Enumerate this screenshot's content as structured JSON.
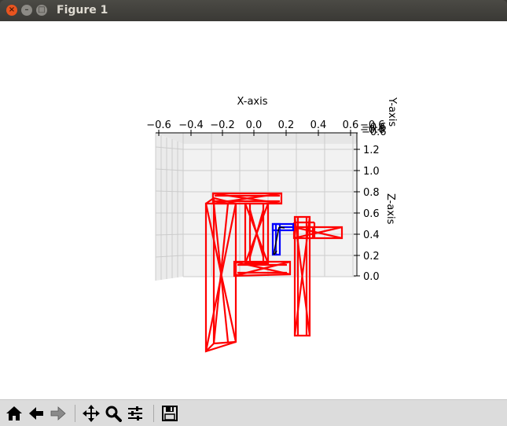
{
  "window": {
    "title": "Figure 1",
    "close_glyph": "×",
    "minimize_glyph": "–",
    "maximize_glyph": "□"
  },
  "axes": {
    "x_label": "X-axis",
    "y_label": "Y-axis",
    "z_label": "Z-axis",
    "x_ticks": [
      "−0.6",
      "−0.4",
      "−0.2",
      "0.0",
      "0.2",
      "0.4",
      "0.6"
    ],
    "z_ticks": [
      "0.0",
      "0.2",
      "0.4",
      "0.6",
      "0.8",
      "1.0",
      "1.2"
    ],
    "y_tick_overlap": "−0.6"
  },
  "colors": {
    "robot_links": "#ff0000",
    "gripper": "#0000ff",
    "pane": "#f2f2f2",
    "grid": "#cccccc"
  },
  "toolbar": {
    "items": [
      {
        "name": "home-icon"
      },
      {
        "name": "back-icon"
      },
      {
        "name": "forward-icon"
      },
      {
        "name": "pan-icon"
      },
      {
        "name": "zoom-icon"
      },
      {
        "name": "configure-subplots-icon"
      },
      {
        "name": "save-icon"
      }
    ]
  }
}
